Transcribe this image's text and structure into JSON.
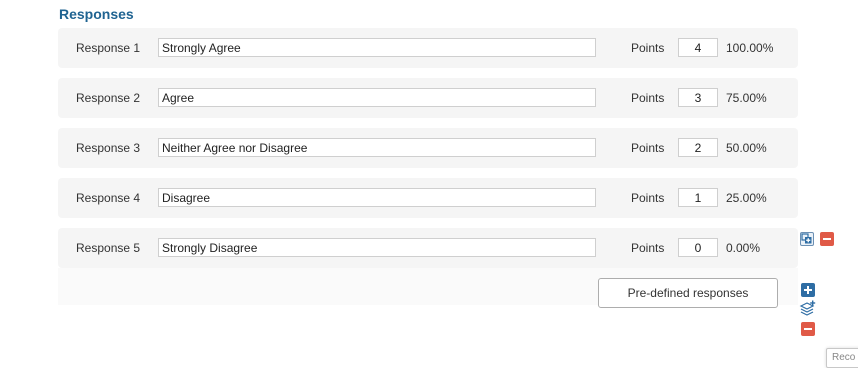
{
  "section": {
    "title": "Responses"
  },
  "responses": [
    {
      "label": "Response 1",
      "text": "Strongly Agree",
      "points_label": "Points",
      "points": "4",
      "percent": "100.00%"
    },
    {
      "label": "Response 2",
      "text": "Agree",
      "points_label": "Points",
      "points": "3",
      "percent": "75.00%"
    },
    {
      "label": "Response 3",
      "text": "Neither Agree nor Disagree",
      "points_label": "Points",
      "points": "2",
      "percent": "50.00%"
    },
    {
      "label": "Response 4",
      "text": "Disagree",
      "points_label": "Points",
      "points": "1",
      "percent": "25.00%"
    },
    {
      "label": "Response 5",
      "text": "Strongly Disagree",
      "points_label": "Points",
      "points": "0",
      "percent": "0.00%"
    }
  ],
  "row_actions": {
    "copy_icon": "duplicate-icon",
    "remove_icon": "minus-icon"
  },
  "actions": {
    "predefined_label": "Pre-defined responses",
    "add_icon": "plus-icon",
    "layers_icon": "layers-add-icon",
    "remove_icon": "minus-icon"
  },
  "tooltip": {
    "text": "Reco"
  },
  "colors": {
    "title": "#1f6391",
    "add": "#2e6da4",
    "remove": "#e05a47"
  }
}
